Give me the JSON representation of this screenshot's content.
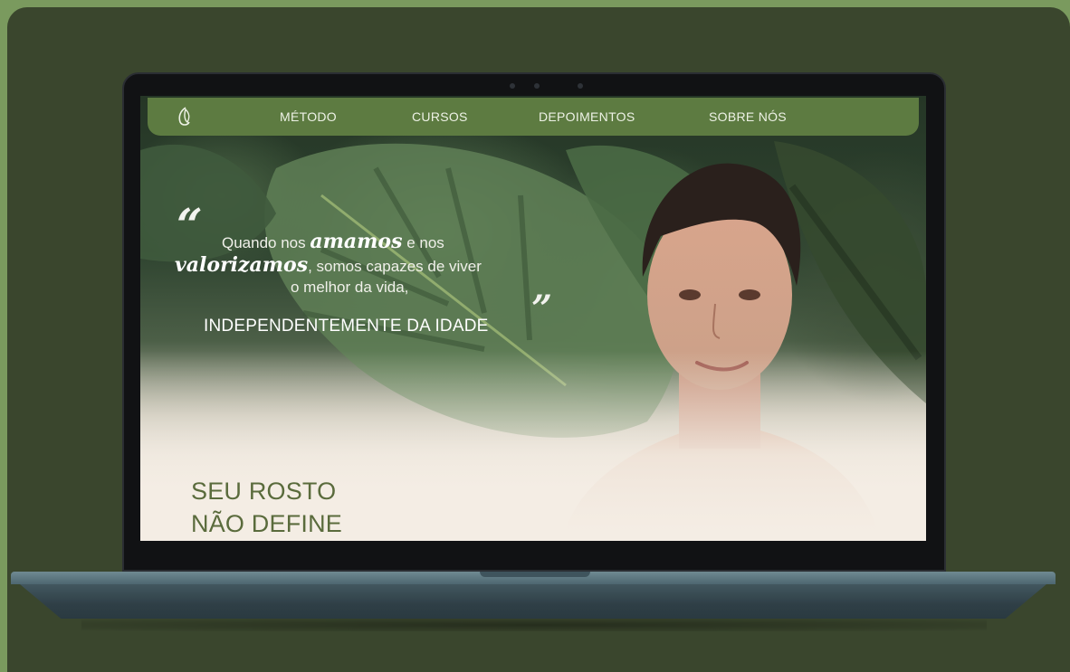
{
  "nav": {
    "logo_icon": "face-leaf-logo-icon",
    "items": [
      {
        "label": "MÉTODO"
      },
      {
        "label": "CURSOS"
      },
      {
        "label": "DEPOIMENTOS"
      },
      {
        "label": "SOBRE NÓS"
      }
    ]
  },
  "hero": {
    "quote_open": "“",
    "quote_close": "”",
    "line1_pre": "Quando nos ",
    "line1_script": "amamos",
    "line1_post": " e nos",
    "line2_script": "valorizamos",
    "line2_post": ", somos capazes de viver",
    "line3": "o melhor da vida,",
    "emphasis": "INDEPENDENTEMENTE DA IDADE",
    "headline_line1": "SEU ROSTO",
    "headline_line2": "NÃO DEFINE"
  },
  "colors": {
    "backdrop": "#3a462d",
    "nav_bg": "#5d7b41",
    "headline": "#5a6b3c",
    "page_bg": "#7a9a5e"
  }
}
